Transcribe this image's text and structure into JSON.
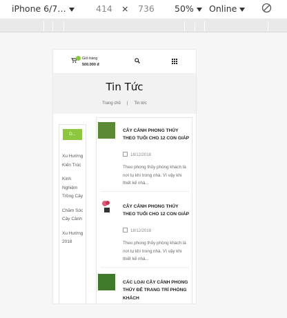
{
  "devtools": {
    "device": "iPhone 6/7…",
    "width": "414",
    "times": "×",
    "height": "736",
    "zoom": "50%",
    "network": "Online"
  },
  "header": {
    "cart_title": "Giỏ hàng",
    "cart_total": "500.000 đ"
  },
  "banner": {
    "title": "Tin Tức",
    "crumb_home": "Trang chủ",
    "crumb_sep": "|",
    "crumb_current": "Tin tức"
  },
  "sidebar": {
    "button": "D...",
    "links": [
      "Xu Hướng Kiến Trúc",
      "Kinh Nghiệm Trồng Cây",
      "Chăm Sóc Cây Cảnh",
      "Xu Hướng 2018"
    ]
  },
  "posts": [
    {
      "title": "CÂY CẢNH PHONG THỦY THEO TUỔI CHO 12 CON GIÁP",
      "date": "18/12/2018",
      "excerpt": "Theo phong thủy phòng khách là nơi tụ khí trong nhà. Vì vậy khi thiết kế nhà..."
    },
    {
      "title": "CÂY CẢNH PHONG THỦY THEO TUỔI CHO 12 CON GIÁP",
      "date": "18/12/2018",
      "excerpt": "Theo phong thủy phòng khách là nơi tụ khí trong nhà. Vì vậy khi thiết kế nhà..."
    },
    {
      "title": "CÁC LOẠI CÂY CẢNH PHONG THỦY ĐỂ TRANG TRÍ PHÒNG KHÁCH",
      "date": "",
      "excerpt": ""
    }
  ],
  "colors": {
    "accent": "#8dc63f"
  }
}
